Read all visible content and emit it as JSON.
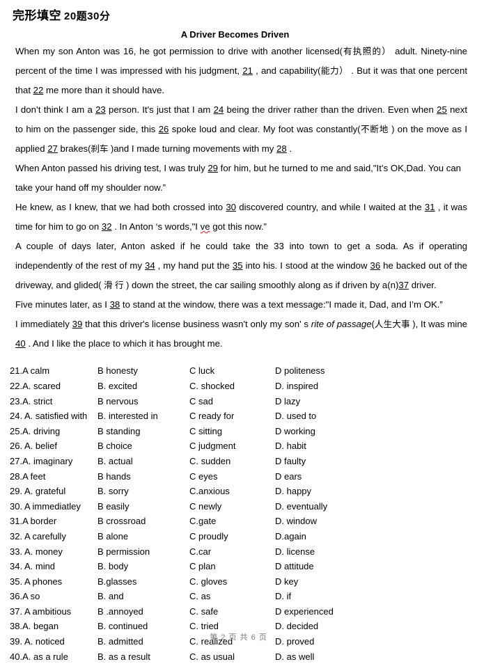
{
  "header": {
    "section_title": "完形填空",
    "score_note": "20题30分"
  },
  "passage": {
    "title": "A Driver Becomes Driven",
    "paragraphs": [
      {
        "id": "p1",
        "segments": [
          {
            "t": "text",
            "v": "When my son Anton was 16, he got permission to drive with another licensed"
          },
          {
            "t": "cn",
            "v": "(有执照的）"
          },
          {
            "t": "text",
            "v": "  adult. Ninety-nine percent of the time I was impressed with his judgment, "
          },
          {
            "t": "blank",
            "v": "21"
          },
          {
            "t": "text",
            "v": " , and capability"
          },
          {
            "t": "cn",
            "v": "(能力）"
          },
          {
            "t": "text",
            "v": " . But it was that one percent that "
          },
          {
            "t": "blank",
            "v": "22"
          },
          {
            "t": "text",
            "v": " me more than it should have."
          }
        ]
      },
      {
        "id": "p2",
        "segments": [
          {
            "t": "text",
            "v": "I don’t think I am a "
          },
          {
            "t": "blank",
            "v": "23"
          },
          {
            "t": "text",
            "v": "  person. It's just that I am   "
          },
          {
            "t": "blank",
            "v": "24"
          },
          {
            "t": "text",
            "v": "   being the driver rather than the driven. Even when "
          },
          {
            "t": "blank",
            "v": "25"
          },
          {
            "t": "text",
            "v": " next to him on the passenger side, this "
          },
          {
            "t": "blank",
            "v": "26"
          },
          {
            "t": "text",
            "v": " spoke loud and clear. My foot was constantly"
          },
          {
            "t": "cn",
            "v": "(不断地 )"
          },
          {
            "t": "text",
            "v": " on the move as I applied "
          },
          {
            "t": "blank",
            "v": "27"
          },
          {
            "t": "text",
            "v": " brakes"
          },
          {
            "t": "cn",
            "v": "(刹车 )"
          },
          {
            "t": "text",
            "v": "and I made turning movements with my "
          },
          {
            "t": "blank",
            "v": "28"
          },
          {
            "t": "text",
            "v": " ."
          }
        ]
      },
      {
        "id": "p3",
        "segments": [
          {
            "t": "text",
            "v": "When Anton passed his driving test, I was truly "
          },
          {
            "t": "blank",
            "v": "29"
          },
          {
            "t": "text",
            "v": " for him, but he turned to me and said,\"It’s OK,Dad. You can take your hand off my shoulder now.”"
          }
        ]
      },
      {
        "id": "p4",
        "segments": [
          {
            "t": "text",
            "v": "He knew, as I knew, that we had both crossed into "
          },
          {
            "t": "blank",
            "v": "30"
          },
          {
            "t": "text",
            "v": " discovered country, and while I waited at the "
          },
          {
            "t": "blank",
            "v": "31"
          },
          {
            "t": "text",
            "v": " , it was time for him to go on "
          },
          {
            "t": "blank",
            "v": "32"
          },
          {
            "t": "text",
            "v": " . In Anton ‘s words,\"I "
          },
          {
            "t": "spell",
            "v": "ve"
          },
          {
            "t": "text",
            "v": " got this now.”"
          }
        ]
      },
      {
        "id": "p5",
        "segments": [
          {
            "t": "text",
            "v": "A couple of days later, Anton asked if he could take the "
          },
          {
            "t": "plain",
            "v": "33"
          },
          {
            "t": "text",
            "v": " into town to get a soda. As if operating independently of the rest of my "
          },
          {
            "t": "blank",
            "v": "34"
          },
          {
            "t": "text",
            "v": " , my hand put the "
          },
          {
            "t": "blank",
            "v": "35"
          },
          {
            "t": "text",
            "v": "  into his. I stood at the window "
          },
          {
            "t": "blank",
            "v": "36"
          },
          {
            "t": "text",
            "v": "  he backed out of the driveway, and glided"
          },
          {
            "t": "cn",
            "v": "( 滑 行  )"
          },
          {
            "t": "text",
            "v": " down the street, the car sailing smoothly along as if driven by a(n)"
          },
          {
            "t": "blank",
            "v": "37"
          },
          {
            "t": "text",
            "v": " driver."
          }
        ]
      },
      {
        "id": "p6",
        "segments": [
          {
            "t": "text",
            "v": "Five minutes later, as I "
          },
          {
            "t": "blank",
            "v": "38"
          },
          {
            "t": "text",
            "v": " to stand at the window, there was a text message:\"I made it, Dad, and I’m OK.”"
          }
        ]
      },
      {
        "id": "p7",
        "segments": [
          {
            "t": "text",
            "v": "I immediately "
          },
          {
            "t": "blank",
            "v": "39"
          },
          {
            "t": "text",
            "v": " that this driver's license business wasn't only my son' s "
          },
          {
            "t": "italic",
            "v": "rite of passage"
          },
          {
            "t": "cn",
            "v": "(人生大事 )"
          },
          {
            "t": "text",
            "v": ", It was mine "
          },
          {
            "t": "blank",
            "v": "40"
          },
          {
            "t": "text",
            "v": " . And I like the place to which it has brought me."
          }
        ]
      }
    ]
  },
  "options": [
    {
      "num": "21.",
      "a": "A calm",
      "b": "B honesty",
      "c": "C luck",
      "d": "D politeness"
    },
    {
      "num": "22.",
      "a": "A. scared",
      "b": "B. excited",
      "c": "C. shocked",
      "d": "D. inspired"
    },
    {
      "num": "23.",
      "a": "A. strict",
      "b": "B nervous",
      "c": "C sad",
      "d": "D lazy"
    },
    {
      "num": "24. ",
      "a": "A. satisfied with",
      "b": "B. interested in",
      "c": "C ready for",
      "d": "D. used to"
    },
    {
      "num": "25.",
      "a": "A. driving",
      "b": "B standing",
      "c": "C sitting",
      "d": "D working"
    },
    {
      "num": "26. ",
      "a": "A. belief",
      "b": "B choice",
      "c": "C judgment",
      "d": "D. habit"
    },
    {
      "num": "27.",
      "a": "A. imaginary",
      "b": "B. actual",
      "c": "C. sudden",
      "d": "D faulty"
    },
    {
      "num": "28.",
      "a": "A feet",
      "b": "B hands",
      "c": "C eyes",
      "d": "D ears"
    },
    {
      "num": "29. ",
      "a": "A. grateful",
      "b": "B. sorry",
      "c": "C.anxious",
      "d": "D. happy"
    },
    {
      "num": "30. ",
      "a": "A immediatley",
      "b": "B easily",
      "c": "C newly",
      "d": "D. eventually"
    },
    {
      "num": "31.",
      "a": "A border",
      "b": "B crossroad",
      "c": "C.gate",
      "d": "D. window"
    },
    {
      "num": "32. ",
      "a": "A carefully",
      "b": "B alone",
      "c": "C proudly",
      "d": "D.again"
    },
    {
      "num": "33. ",
      "a": "A. money",
      "b": "B permission",
      "c": "C.car",
      "d": "D. license"
    },
    {
      "num": "34. ",
      "a": "A. mind",
      "b": "B. body",
      "c": "C plan",
      "d": "D attitude"
    },
    {
      "num": "35. ",
      "a": "A phones",
      "b": "B.glasses",
      "c": "C. gloves",
      "d": "D key"
    },
    {
      "num": "36.",
      "a": "A so",
      "b": "B. and",
      "c": "C. as",
      "d": "D. if"
    },
    {
      "num": "37. ",
      "a": "A ambitious",
      "b": "B .annoyed",
      "c": "C. safe",
      "d": "D experienced"
    },
    {
      "num": "38.",
      "a": "A. began",
      "b": "B. continued",
      "c": "C. tried",
      "d": "D. decided"
    },
    {
      "num": "39. ",
      "a": "A. noticed",
      "b": "B. admitted",
      "c": "C. realized",
      "d": "D. proved"
    },
    {
      "num": "40.",
      "a": "A. as a rule",
      "b": "B. as a result",
      "c": "C. as usual",
      "d": "D. as well"
    }
  ],
  "footer": {
    "page_info": "第 2 页  共 6 页"
  }
}
